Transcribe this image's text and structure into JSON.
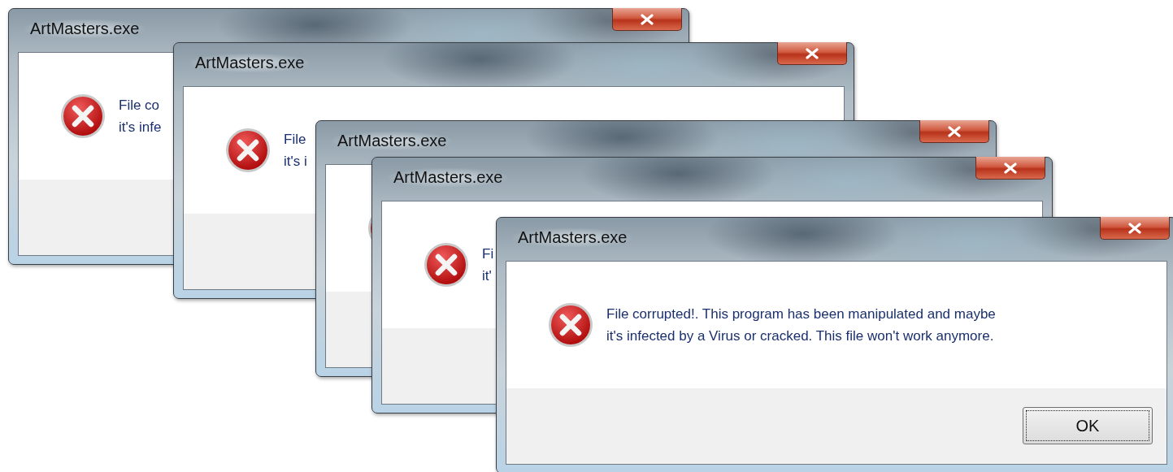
{
  "windows": [
    {
      "title": "ArtMasters.exe",
      "message_lines": [
        "File co",
        "it's infe"
      ]
    },
    {
      "title": "ArtMasters.exe",
      "message_lines": [
        "File",
        "it's i"
      ]
    },
    {
      "title": "ArtMasters.exe"
    },
    {
      "title": "ArtMasters.exe",
      "message_lines": [
        "Fi",
        "it'"
      ]
    },
    {
      "title": "ArtMasters.exe",
      "message_lines": [
        "File corrupted!. This program has been manipulated and maybe",
        "it's infected by a Virus or cracked. This file won't work anymore."
      ],
      "button": "OK"
    }
  ]
}
